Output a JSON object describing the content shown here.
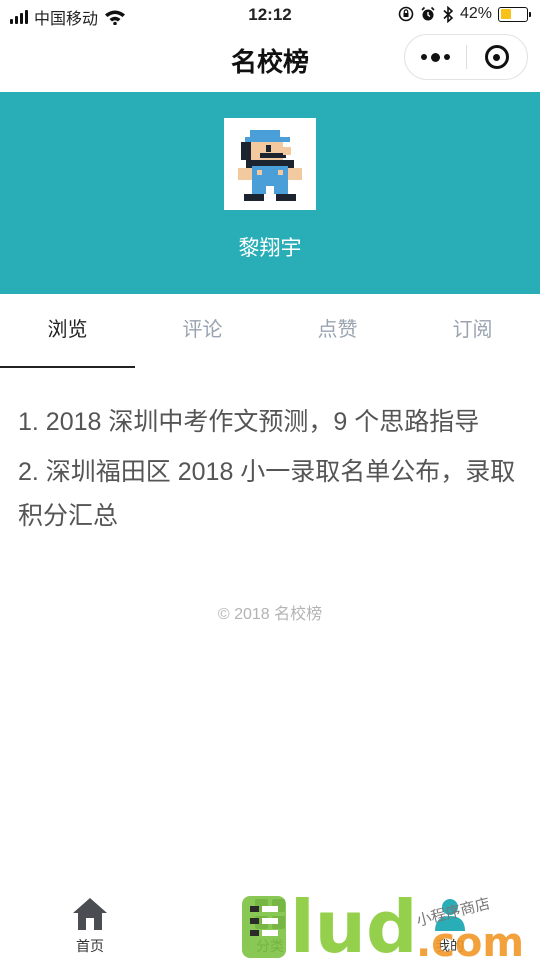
{
  "status_bar": {
    "carrier": "中国移动",
    "time": "12:12",
    "battery_percent": "42%",
    "battery_level": 0.42
  },
  "nav": {
    "title": "名校榜"
  },
  "profile": {
    "username": "黎翔宇",
    "header_color": "#29aeb8"
  },
  "tabs": [
    {
      "label": "浏览",
      "active": true
    },
    {
      "label": "评论",
      "active": false
    },
    {
      "label": "点赞",
      "active": false
    },
    {
      "label": "订阅",
      "active": false
    }
  ],
  "history": [
    "1. 2018 深圳中考作文预测，9 个思路指导",
    "2. 深圳福田区 2018 小一录取名单公布，录取积分汇总"
  ],
  "copyright": "© 2018 名校榜",
  "tabbar": [
    {
      "label": "首页",
      "icon": "home-icon"
    },
    {
      "label": "分类",
      "icon": "category-icon"
    },
    {
      "label": "我的",
      "icon": "user-icon"
    }
  ],
  "watermark": {
    "brand": "lud",
    "domain": ".com",
    "tagline": "小程序商店"
  }
}
